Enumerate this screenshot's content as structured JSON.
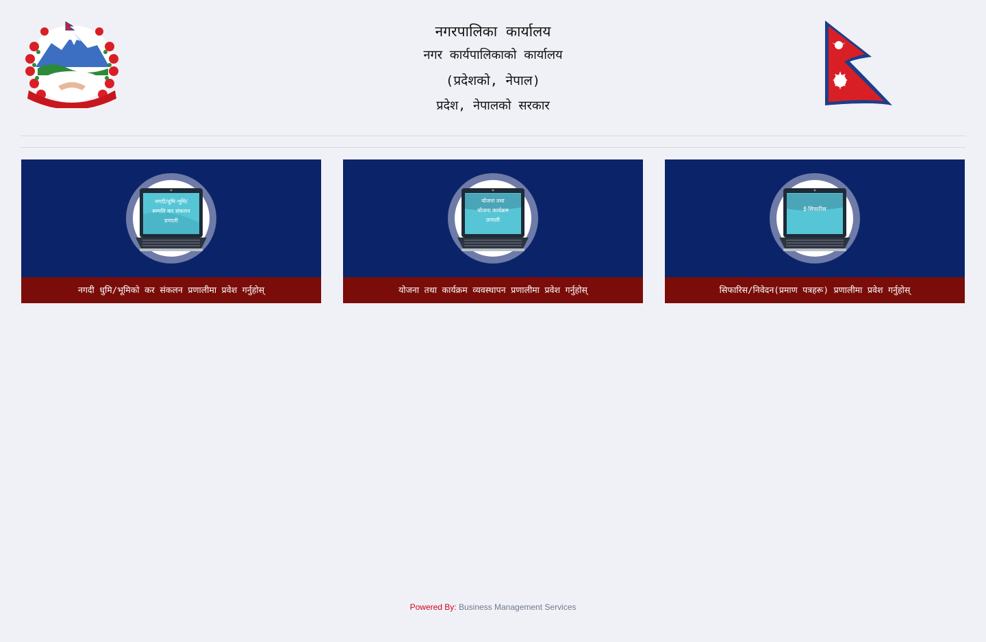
{
  "header": {
    "line1": "नगरपालिका कार्यालय",
    "line2": "नगर कार्यपालिकाको कार्यालय",
    "line3": "(प्रदेशको, नेपाल)",
    "line4": "प्रदेश, नेपालको सरकार"
  },
  "cards": [
    {
      "screen_lines": [
        "नगदी/धुमि-भूमि/",
        "सम्पति कर संकलन",
        "प्रणाली"
      ],
      "caption": "नगदी धुमि/भूमिको कर संकलन प्रणालीमा प्रवेश गर्नुहोस्"
    },
    {
      "screen_lines": [
        "योजना तथा",
        "योजना कार्यक्रम",
        "प्रणाली"
      ],
      "caption": "योजना तथा कार्यक्रम व्यवस्थापन प्रणालीमा प्रवेश गर्नुहोस्"
    },
    {
      "screen_lines": [
        "ई-सिफारिस"
      ],
      "caption": "सिफारिस/निवेदन(प्रमाण पत्रहरू) प्रणालीमा प्रवेश गर्नुहोस्"
    }
  ],
  "footer": {
    "powered_by": "Powered By:",
    "company": "Business Management Services"
  },
  "colors": {
    "card_bg": "#0b2469",
    "caption_bg": "#7a0d09",
    "ring": "#6e7ba8",
    "screen": "#56c6d6"
  },
  "icons": {
    "left_logo": "nepal-emblem-icon",
    "right_logo": "nepal-flag-icon",
    "card_icon": "laptop-icon"
  }
}
